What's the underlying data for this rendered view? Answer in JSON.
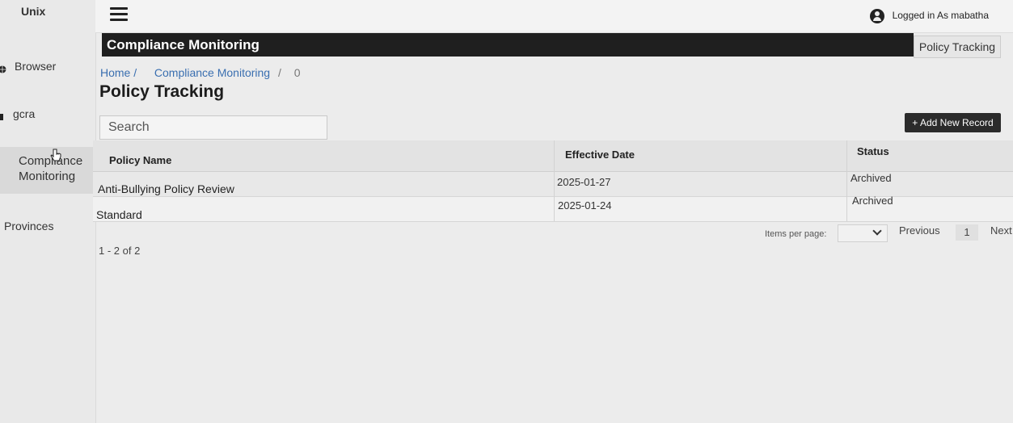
{
  "sidebar": {
    "brand": "Unix",
    "items": [
      {
        "label": "Browser"
      },
      {
        "label": "gcra"
      },
      {
        "label_line1": "Compliance",
        "label_line2": "Monitoring"
      },
      {
        "label": "Provinces"
      }
    ]
  },
  "topbar": {
    "user_text": "Logged in As mabatha"
  },
  "header": {
    "title": "Compliance Monitoring",
    "tab": "Policy Tracking"
  },
  "breadcrumb": {
    "home": "Home /",
    "section": "Compliance Monitoring",
    "sep": "/",
    "current": "0"
  },
  "page": {
    "title": "Policy Tracking",
    "search_placeholder": "Search",
    "add_button": "+ Add New Record"
  },
  "table": {
    "columns": [
      "Policy Name",
      "Effective Date",
      "Status"
    ],
    "rows": [
      {
        "name": "Anti-Bullying Policy Review",
        "date": "2025-01-27",
        "status": "Archived"
      },
      {
        "name": "Standard",
        "date": "2025-01-24",
        "status": "Archived"
      }
    ]
  },
  "pagination": {
    "count_text": "1 - 2 of 2",
    "items_per_page_label": "Items per page:",
    "items_per_page_value": "",
    "previous": "Previous",
    "page": "1",
    "next": "Next"
  }
}
